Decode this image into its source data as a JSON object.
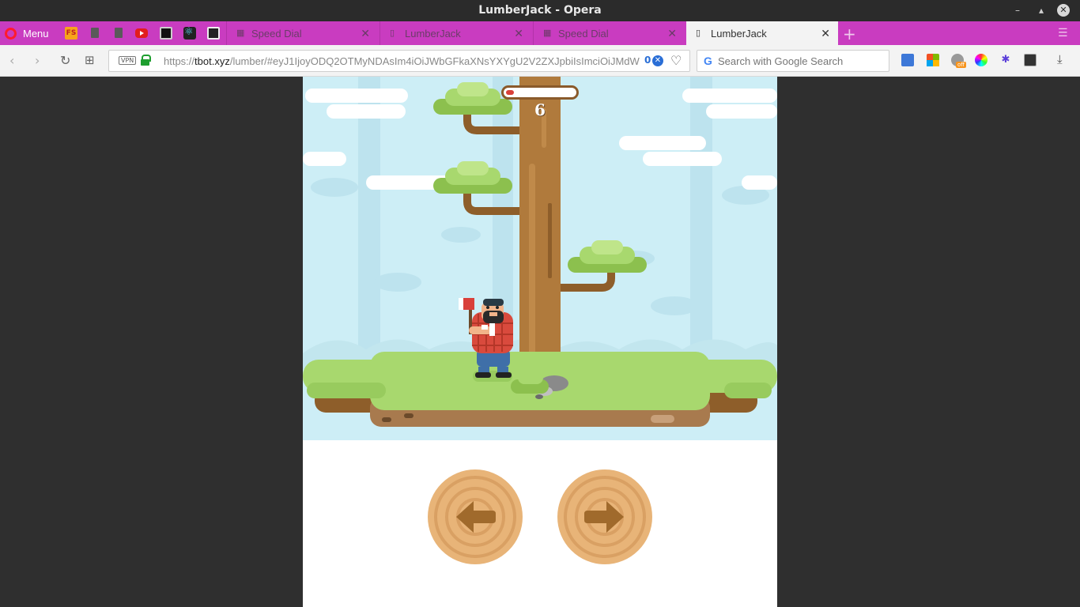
{
  "window": {
    "title": "LumberJack - Opera"
  },
  "tabbar": {
    "menu_label": "Menu",
    "pinned": [
      {
        "icon": "fs-icon",
        "text": "FS"
      },
      {
        "icon": "document-icon"
      },
      {
        "icon": "document-icon"
      },
      {
        "icon": "youtube-icon"
      },
      {
        "icon": "photo-icon"
      },
      {
        "icon": "react-icon"
      },
      {
        "icon": "trello-icon"
      }
    ],
    "tabs": [
      {
        "label": "Speed Dial",
        "icon": "speed-dial-icon",
        "active": false
      },
      {
        "label": "LumberJack",
        "icon": "document-icon",
        "active": false
      },
      {
        "label": "Speed Dial",
        "icon": "speed-dial-icon",
        "active": false
      },
      {
        "label": "LumberJack",
        "icon": "document-icon",
        "active": true
      }
    ]
  },
  "addressbar": {
    "vpn_label": "VPN",
    "url_prefix": "https://",
    "url_host": "tbot.xyz",
    "url_path": "/lumber/#eyJ1IjoyODQ2OTMyNDAsIm4iOiJWbGFkaXNsYXYgU2V2ZXJpbiIsImciOiJMdW",
    "adblock_count": "0",
    "search_placeholder": "Search with Google Search"
  },
  "game": {
    "score": "6",
    "time_remaining": 0.12,
    "controls": {
      "left_icon": "arrow-left-icon",
      "right_icon": "arrow-right-icon"
    },
    "colors": {
      "sky": "#cdeef6",
      "grass": "#a8d86e",
      "trunk": "#b07a3c",
      "leaves": "#8cc04e",
      "button": "#e8b478",
      "shirt": "#d94a3d"
    }
  }
}
